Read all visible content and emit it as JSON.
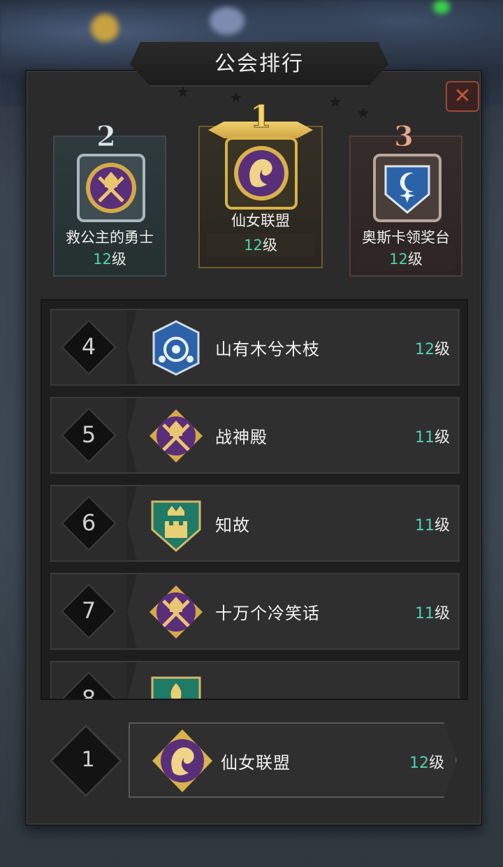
{
  "title": "公会排行",
  "close_icon": "close-icon",
  "level_suffix": "级",
  "colors": {
    "level_accent": "#4fd1b2",
    "gold": "#d8b24a",
    "purple": "#5a2f7a",
    "blue": "#2c63a8",
    "teal": "#1f7a66"
  },
  "podium": [
    {
      "rank": "2",
      "name": "救公主的勇士",
      "level": "12",
      "emblem": "knight-axes-emblem-icon"
    },
    {
      "rank": "1",
      "name": "仙女联盟",
      "level": "12",
      "emblem": "fairy-hair-emblem-icon"
    },
    {
      "rank": "3",
      "name": "奥斯卡领奖台",
      "level": "12",
      "emblem": "moon-star-emblem-icon"
    }
  ],
  "list": [
    {
      "rank": "4",
      "name": "山有木兮木枝",
      "level": "12",
      "emblem": "blue-swirl-emblem-icon"
    },
    {
      "rank": "5",
      "name": "战神殿",
      "level": "11",
      "emblem": "knight-axes-emblem-icon"
    },
    {
      "rank": "6",
      "name": "知故",
      "level": "11",
      "emblem": "castle-crown-emblem-icon"
    },
    {
      "rank": "7",
      "name": "十万个冷笑话",
      "level": "11",
      "emblem": "knight-axes-emblem-icon"
    },
    {
      "rank": "8",
      "name": "",
      "level": "",
      "emblem": "green-leaf-emblem-icon"
    }
  ],
  "self": {
    "rank": "1",
    "name": "仙女联盟",
    "level": "12",
    "emblem": "fairy-hair-emblem-icon"
  }
}
